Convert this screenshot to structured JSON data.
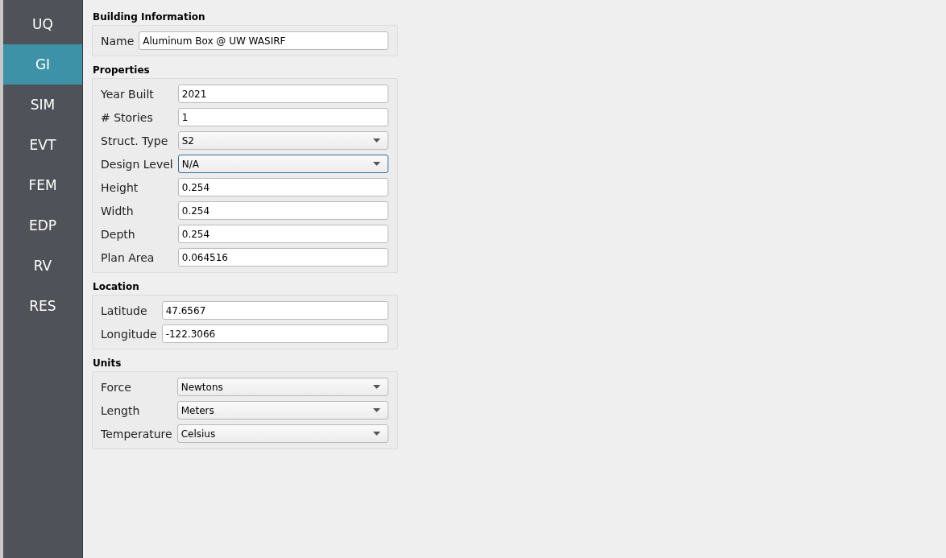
{
  "sidebar": {
    "items": [
      {
        "label": "UQ",
        "selected": false
      },
      {
        "label": "GI",
        "selected": true
      },
      {
        "label": "SIM",
        "selected": false
      },
      {
        "label": "EVT",
        "selected": false
      },
      {
        "label": "FEM",
        "selected": false
      },
      {
        "label": "EDP",
        "selected": false
      },
      {
        "label": "RV",
        "selected": false
      },
      {
        "label": "RES",
        "selected": false
      }
    ]
  },
  "groups": [
    {
      "title": "Building Information",
      "fields": [
        {
          "label": "Name",
          "kind": "text",
          "value": "Aluminum Box @ UW WASIRF",
          "focused": false
        }
      ]
    },
    {
      "title": "Properties",
      "fields": [
        {
          "label": "Year Built",
          "kind": "text",
          "value": "2021",
          "focused": false
        },
        {
          "label": "# Stories",
          "kind": "text",
          "value": "1",
          "focused": false
        },
        {
          "label": "Struct. Type",
          "kind": "dropdown",
          "value": "S2",
          "focused": false
        },
        {
          "label": "Design Level",
          "kind": "dropdown",
          "value": "N/A",
          "focused": true
        },
        {
          "label": "Height",
          "kind": "text",
          "value": "0.254",
          "focused": false
        },
        {
          "label": "Width",
          "kind": "text",
          "value": "0.254",
          "focused": false
        },
        {
          "label": "Depth",
          "kind": "text",
          "value": "0.254",
          "focused": false
        },
        {
          "label": "Plan Area",
          "kind": "text",
          "value": "0.064516",
          "focused": false
        }
      ]
    },
    {
      "title": "Location",
      "fields": [
        {
          "label": "Latitude",
          "kind": "text",
          "value": "47.6567",
          "focused": false
        },
        {
          "label": "Longitude",
          "kind": "text",
          "value": "-122.3066",
          "focused": false
        }
      ]
    },
    {
      "title": "Units",
      "fields": [
        {
          "label": "Force",
          "kind": "dropdown",
          "value": "Newtons",
          "focused": false
        },
        {
          "label": "Length",
          "kind": "dropdown",
          "value": "Meters",
          "focused": false
        },
        {
          "label": "Temperature",
          "kind": "dropdown",
          "value": "Celsius",
          "focused": false
        }
      ]
    }
  ]
}
